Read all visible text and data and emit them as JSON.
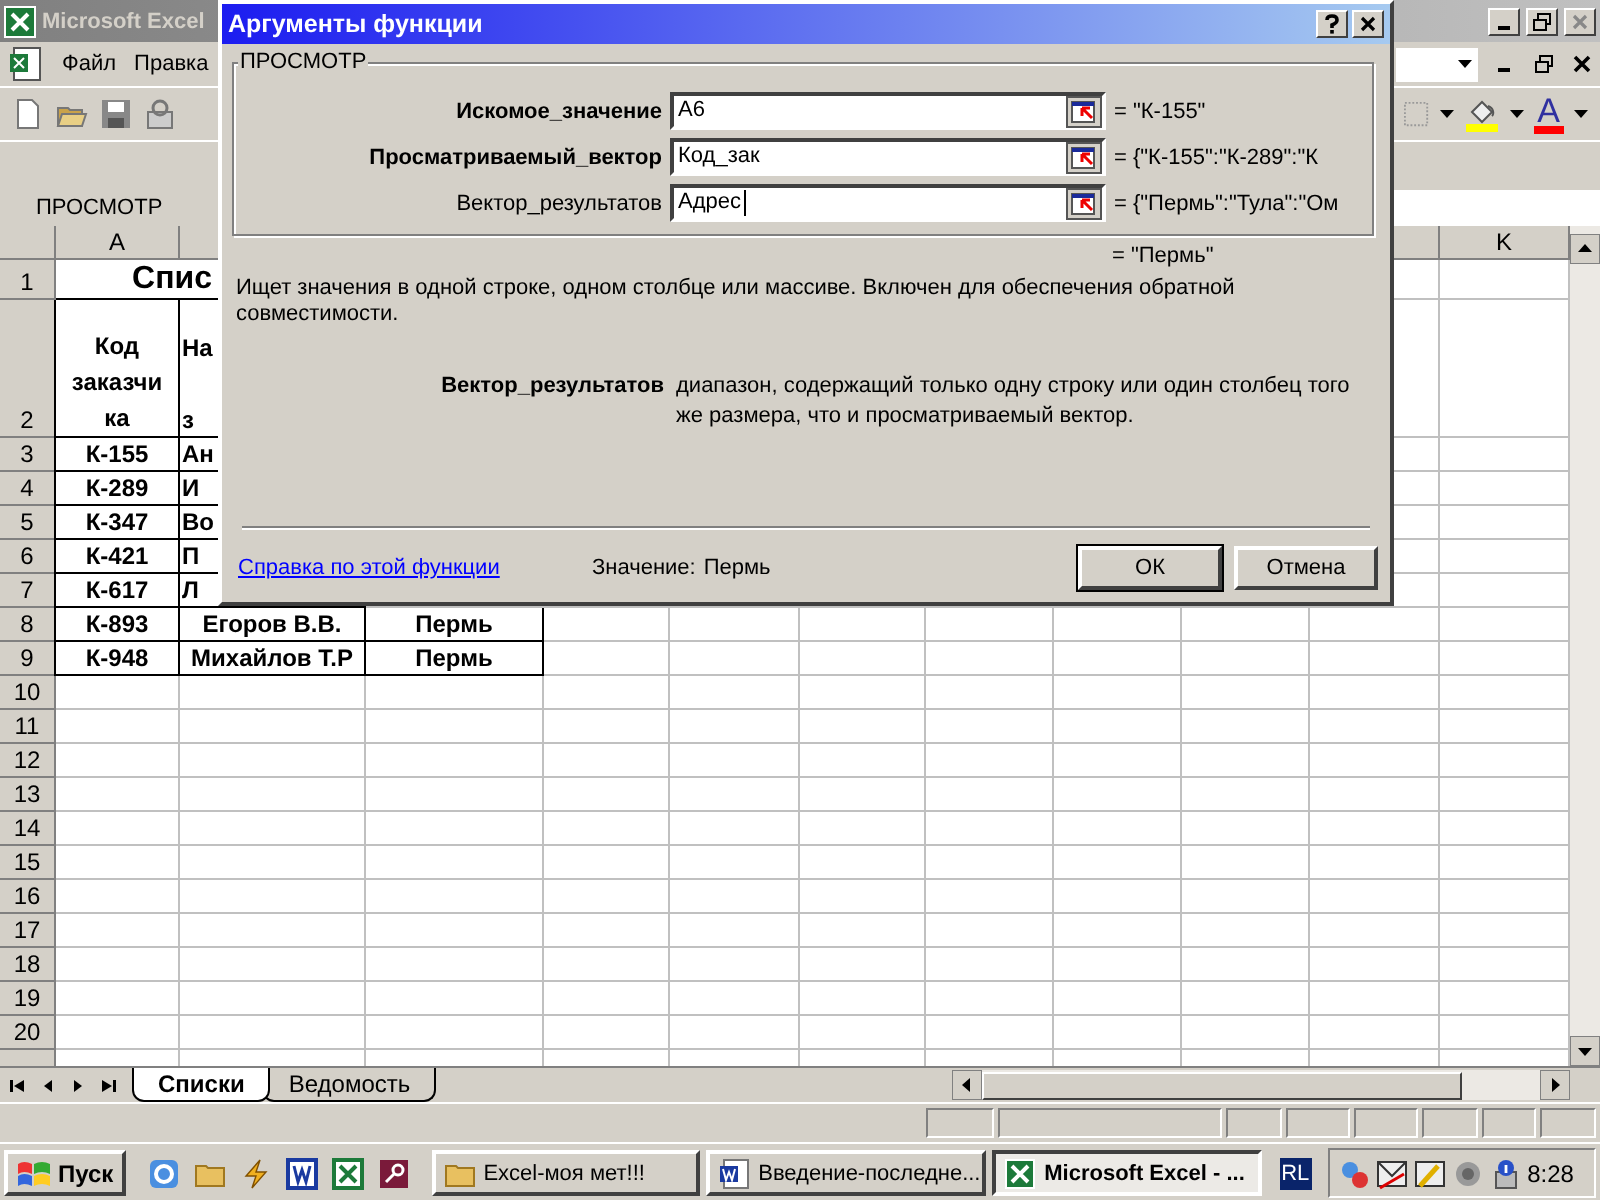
{
  "excel": {
    "title": "Microsoft Excel",
    "menu": [
      {
        "label": "Файл"
      },
      {
        "label": "Правка"
      }
    ],
    "font_color_glyph": "A",
    "name_box": "ПРОСМОТР",
    "column_headers": {
      "first": "A",
      "last": "K"
    },
    "rows": [
      {
        "number": "1",
        "title": "Спис"
      },
      {
        "number": "2",
        "a_lines": [
          "Код",
          "заказчи",
          "ка"
        ],
        "b_lines": [
          "На",
          "з"
        ]
      },
      {
        "number": "3",
        "a": "К-155",
        "b": "Ан"
      },
      {
        "number": "4",
        "a": "К-289",
        "b": "И"
      },
      {
        "number": "5",
        "a": "К-347",
        "b": "Во"
      },
      {
        "number": "6",
        "a": "К-421",
        "b": "П"
      },
      {
        "number": "7",
        "a": "К-617",
        "b": "Л"
      },
      {
        "number": "8",
        "a": "К-893",
        "b": "Егоров В.В.",
        "c": "Пермь"
      },
      {
        "number": "9",
        "a": "К-948",
        "b": "Михайлов Т.Р",
        "c": "Пермь"
      },
      {
        "number": "10"
      },
      {
        "number": "11"
      },
      {
        "number": "12"
      },
      {
        "number": "13"
      },
      {
        "number": "14"
      },
      {
        "number": "15"
      },
      {
        "number": "16"
      },
      {
        "number": "17"
      },
      {
        "number": "18"
      },
      {
        "number": "19"
      },
      {
        "number": "20"
      }
    ],
    "sheet_tabs": [
      {
        "label": "Списки",
        "selected": true
      },
      {
        "label": "Ведомость",
        "selected": false
      }
    ]
  },
  "dialog": {
    "title": "Аргументы функции",
    "group_title": "ПРОСМОТР",
    "arguments": [
      {
        "label": "Искомое_значение",
        "required": true,
        "value": "A6",
        "focused": false,
        "result": "= \"К-155\""
      },
      {
        "label": "Просматриваемый_вектор",
        "required": true,
        "value": "Код_зак",
        "focused": false,
        "result": "= {\"К-155\":\"К-289\":\"К"
      },
      {
        "label": "Вектор_результатов",
        "required": false,
        "value": "Адрес",
        "focused": true,
        "result": "= {\"Пермь\":\"Тула\":\"Ом"
      }
    ],
    "function_result": "= \"Пермь\"",
    "description": "Ищет значения в одной строке, одном столбце или массиве. Включен для обеспечения обратной совместимости.",
    "argument_help": {
      "name": "Вектор_результатов",
      "text": "диапазон, содержащий только одну строку или один столбец того же размера, что и просматриваемый вектор."
    },
    "help_link": "Справка по этой функции",
    "value_label": "Значение:",
    "value": "Пермь",
    "buttons": [
      {
        "label": "ОК",
        "default": true
      },
      {
        "label": "Отмена",
        "default": false
      }
    ]
  },
  "taskbar": {
    "start": "Пуск",
    "tasks": [
      {
        "label": "Excel-моя мет!!!",
        "kind": "folder",
        "selected": false
      },
      {
        "label": "Введение-последне...",
        "kind": "word",
        "selected": false
      },
      {
        "label": "Microsoft Excel - ...",
        "kind": "excel",
        "selected": true
      }
    ],
    "language": "RL",
    "clock": "8:28"
  }
}
